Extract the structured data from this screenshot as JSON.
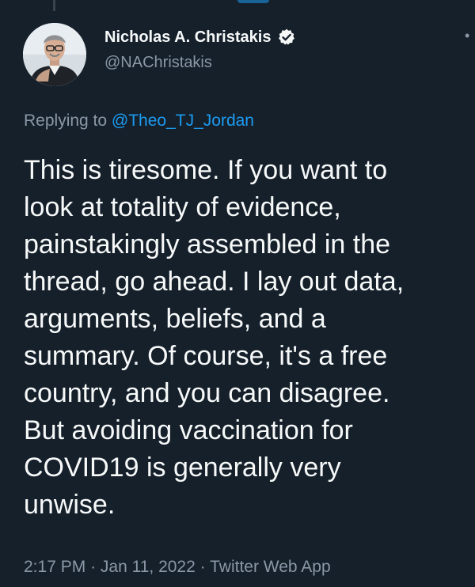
{
  "author": {
    "display_name": "Nicholas A. Christakis",
    "handle": "@NAChristakis",
    "verified": true,
    "verified_icon": "verified-badge-icon"
  },
  "reply": {
    "prefix": "Replying to",
    "mention": "@Theo_TJ_Jordan"
  },
  "tweet": {
    "lines": [
      "This is tiresome. If you want to",
      "look at totality of evidence,",
      "painstakingly assembled in the",
      "thread, go ahead. I lay out data,",
      "arguments, beliefs, and a",
      "summary. Of course, it's a free",
      "country, and you can disagree.",
      "But avoiding vaccination for",
      "COVID19 is generally very",
      "unwise."
    ]
  },
  "meta": {
    "time": "2:17 PM",
    "date": "Jan 11, 2022",
    "source": "Twitter Web App",
    "separator": "·"
  },
  "colors": {
    "background": "#15202b",
    "text_primary": "#f7f9f9",
    "text_secondary": "#8b98a5",
    "accent": "#1d9bf0"
  }
}
